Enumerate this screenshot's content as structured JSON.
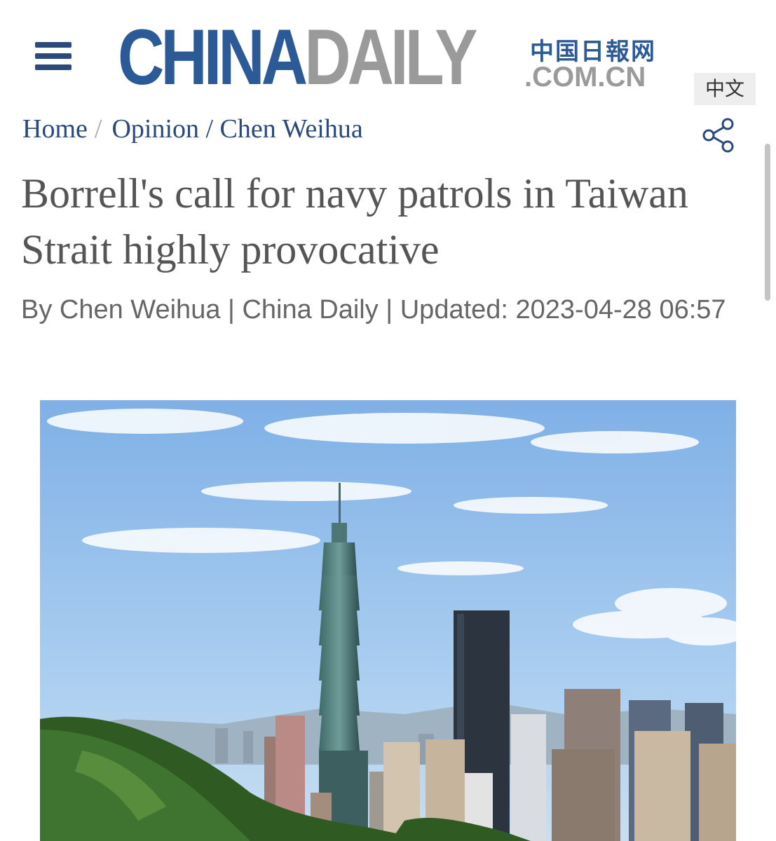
{
  "header": {
    "menu_icon": "hamburger-menu-icon",
    "logo": {
      "china": "CHINA",
      "daily": "DAILY",
      "chinese": "中国日報网",
      "domain": ".COM.CN"
    },
    "lang_switch": "中文",
    "share_icon": "share-icon"
  },
  "breadcrumb": {
    "home": "Home",
    "separator": "/",
    "section": "Opinion / Chen Weihua"
  },
  "article": {
    "headline": "Borrell's call for navy patrols in Taiwan Strait highly provocative",
    "byline": "By Chen Weihua | China Daily | Updated: 2023-04-28 06:57",
    "image_icon": "city-skyline-photo"
  },
  "colors": {
    "brand_blue": "#2b5a97",
    "brand_gray": "#9a9a9a",
    "headline_gray": "#555555"
  }
}
